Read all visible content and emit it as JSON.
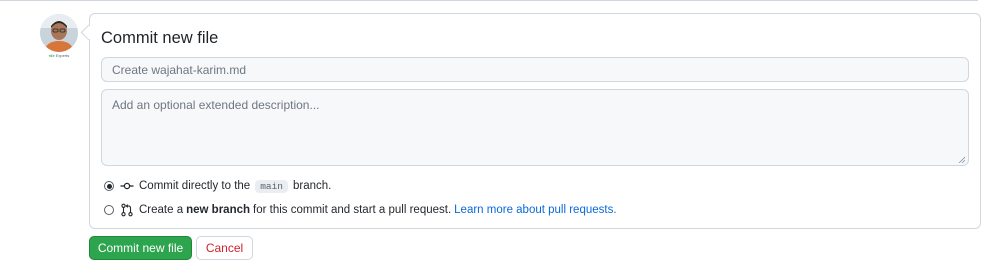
{
  "commit_form": {
    "title": "Commit new file",
    "summary_placeholder": "Create wajahat-karim.md",
    "description_placeholder": "Add an optional extended description...",
    "avatar_caption": "Experts"
  },
  "options": {
    "direct": {
      "text_before": "Commit directly to the",
      "branch": "main",
      "text_after": "branch.",
      "selected": true,
      "icon": "git-commit-icon"
    },
    "new_branch": {
      "text_before": "Create a",
      "strong": "new branch",
      "text_after": "for this commit and start a pull request.",
      "link": "Learn more about pull requests.",
      "selected": false,
      "icon": "git-pull-request-icon"
    }
  },
  "buttons": {
    "commit": "Commit new file",
    "cancel": "Cancel"
  },
  "colors": {
    "primary_button": "#2da44e",
    "cancel_text": "#cf222e",
    "link": "#0969da",
    "border": "#d0d7de"
  }
}
